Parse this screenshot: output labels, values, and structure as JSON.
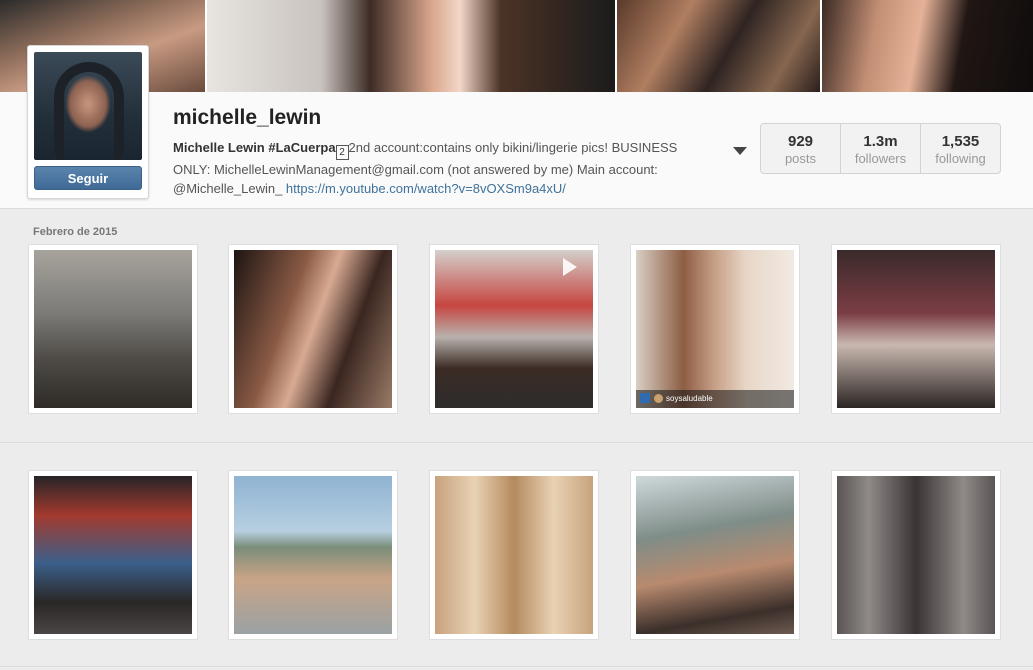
{
  "profile": {
    "username": "michelle_lewin",
    "follow_label": "Seguir",
    "bio_name": "Michelle Lewin #LaCuerpa",
    "bio_text": "2nd account:contains only bikini/lingerie pics! BUSINESS ONLY: MichelleLewinManagement@gmail.com (not answered by me) Main account: @Michelle_Lewin_ ",
    "bio_link": "https://m.youtube.com/watch?v=8vOXSm9a4xU/"
  },
  "stats": [
    {
      "num": "929",
      "label": "posts"
    },
    {
      "num": "1.3m",
      "label": "followers"
    },
    {
      "num": "1,535",
      "label": "following"
    }
  ],
  "feed": {
    "month_label": "Febrero de 2015",
    "tag_handle": "soysaludable",
    "icons": {
      "expand": "chevron-down-icon",
      "play": "play-icon",
      "tag": "repost-icon"
    }
  }
}
